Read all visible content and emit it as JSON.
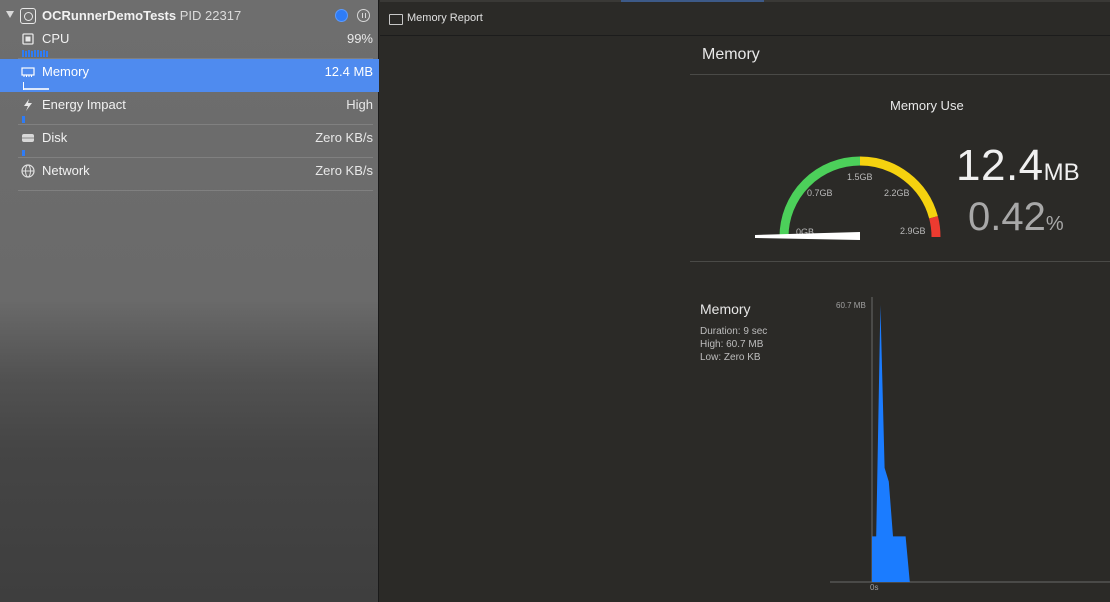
{
  "process": {
    "name": "OCRunnerDemoTests",
    "pid": "PID 22317"
  },
  "gauges": [
    {
      "label": "CPU",
      "value": "99%",
      "icon": "cpu-icon",
      "selected": false
    },
    {
      "label": "Memory",
      "value": "12.4 MB",
      "icon": "memory-chip-icon",
      "selected": true
    },
    {
      "label": "Energy Impact",
      "value": "High",
      "icon": "bolt-icon",
      "selected": false
    },
    {
      "label": "Disk",
      "value": "Zero KB/s",
      "icon": "disk-icon",
      "selected": false
    },
    {
      "label": "Network",
      "value": "Zero KB/s",
      "icon": "globe-icon",
      "selected": false
    }
  ],
  "report": {
    "header_title": "Memory Report",
    "section_title": "Memory",
    "gauge": {
      "title": "Memory Use",
      "ticks": [
        "0GB",
        "0.7GB",
        "1.5GB",
        "2.2GB",
        "2.9GB"
      ],
      "fraction": 0.0042,
      "colors": {
        "green": "#4cd05a",
        "yellow": "#f5d20f",
        "red": "#ec3b30"
      }
    },
    "big_value": "12.4",
    "big_unit": "MB",
    "percent_value": "0.42",
    "percent_unit": "%"
  },
  "timeline": {
    "title": "Memory",
    "duration": "Duration: 9 sec",
    "high": "High: 60.7 MB",
    "low": "Low: Zero KB",
    "y_max_label": "60.7 MB",
    "x_start_label": "0s",
    "color": "#1b7cff",
    "chart_data": {
      "type": "area",
      "x": [
        0,
        0.5,
        1,
        1.5,
        2,
        2.5,
        3,
        3.5,
        4,
        4.5,
        5
      ],
      "values": [
        0,
        10,
        60.7,
        25,
        22,
        10,
        10,
        10,
        10,
        0,
        0
      ],
      "ylim": [
        0,
        60.7
      ],
      "xlabel": "",
      "ylabel": ""
    }
  }
}
